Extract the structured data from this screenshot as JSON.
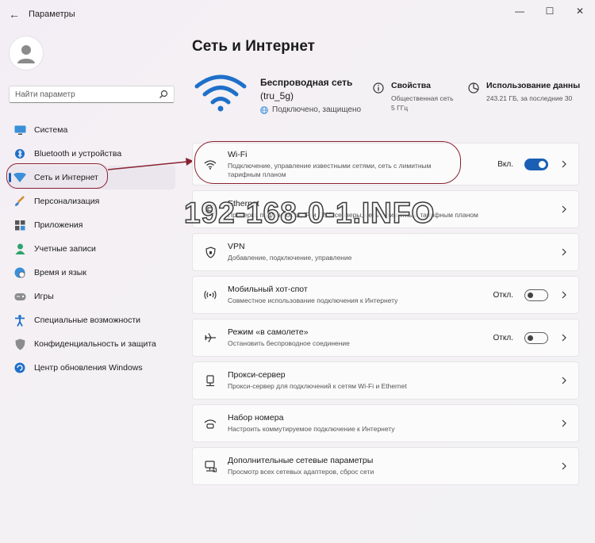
{
  "window": {
    "title": "Параметры",
    "back": "←",
    "minimize": "—",
    "maximize": "☐",
    "close": "✕"
  },
  "search": {
    "placeholder": "Найти параметр"
  },
  "sidebar": {
    "items": [
      {
        "label": "Система",
        "icon": "monitor-icon"
      },
      {
        "label": "Bluetooth и устройства",
        "icon": "bluetooth-icon"
      },
      {
        "label": "Сеть и Интернет",
        "icon": "wifi-diamond-icon",
        "active": true
      },
      {
        "label": "Персонализация",
        "icon": "brush-icon"
      },
      {
        "label": "Приложения",
        "icon": "apps-icon"
      },
      {
        "label": "Учетные записи",
        "icon": "person-icon"
      },
      {
        "label": "Время и язык",
        "icon": "globe-clock-icon"
      },
      {
        "label": "Игры",
        "icon": "gamepad-icon"
      },
      {
        "label": "Специальные возможности",
        "icon": "accessibility-icon"
      },
      {
        "label": "Конфиденциальность и защита",
        "icon": "shield-icon"
      },
      {
        "label": "Центр обновления Windows",
        "icon": "update-icon"
      }
    ]
  },
  "main": {
    "title": "Сеть и Интернет",
    "network": {
      "name_line1": "Беспроводная сеть",
      "name_line2": "(tru_5g)",
      "status": "Подключено, защищено"
    },
    "properties": {
      "title": "Свойства",
      "sub1": "Общественная сеть",
      "sub2": "5 ГГц"
    },
    "usage": {
      "title": "Использование данны",
      "sub": "243.21 ГБ, за последние 30"
    },
    "cards": [
      {
        "title": "Wi-Fi",
        "desc": "Подключение, управление известными сетями, сеть с лимитным тарифным планом",
        "state": "Вкл.",
        "toggle": "on",
        "icon": "wifi-icon"
      },
      {
        "title": "Ethernet",
        "desc": "Проверка подлинности, IP-и DNS-серверы, сеть с лимитным тарифным планом",
        "icon": "ethernet-icon"
      },
      {
        "title": "VPN",
        "desc": "Добавление, подключение, управление",
        "icon": "vpn-shield-icon"
      },
      {
        "title": "Мобильный хот-спот",
        "desc": "Совместное использование подключения к Интернету",
        "state": "Откл.",
        "toggle": "off",
        "icon": "hotspot-icon"
      },
      {
        "title": "Режим «в самолете»",
        "desc": "Остановить беспроводное соединение",
        "state": "Откл.",
        "toggle": "off",
        "icon": "airplane-icon"
      },
      {
        "title": "Прокси-сервер",
        "desc": "Прокси-сервер для подключений к сетям Wi-Fi и Ethernet",
        "icon": "proxy-icon"
      },
      {
        "title": "Набор номера",
        "desc": "Настроить коммутируемое подключение к Интернету",
        "icon": "dialup-icon"
      },
      {
        "title": "Дополнительные сетевые параметры",
        "desc": "Просмотр всех сетевых адаптеров, сброс сети",
        "icon": "network-pc-icon"
      }
    ]
  },
  "watermark": "192-168-0-1.INFO",
  "colors": {
    "accent": "#1a5fb4",
    "annotation": "#8a2131"
  }
}
